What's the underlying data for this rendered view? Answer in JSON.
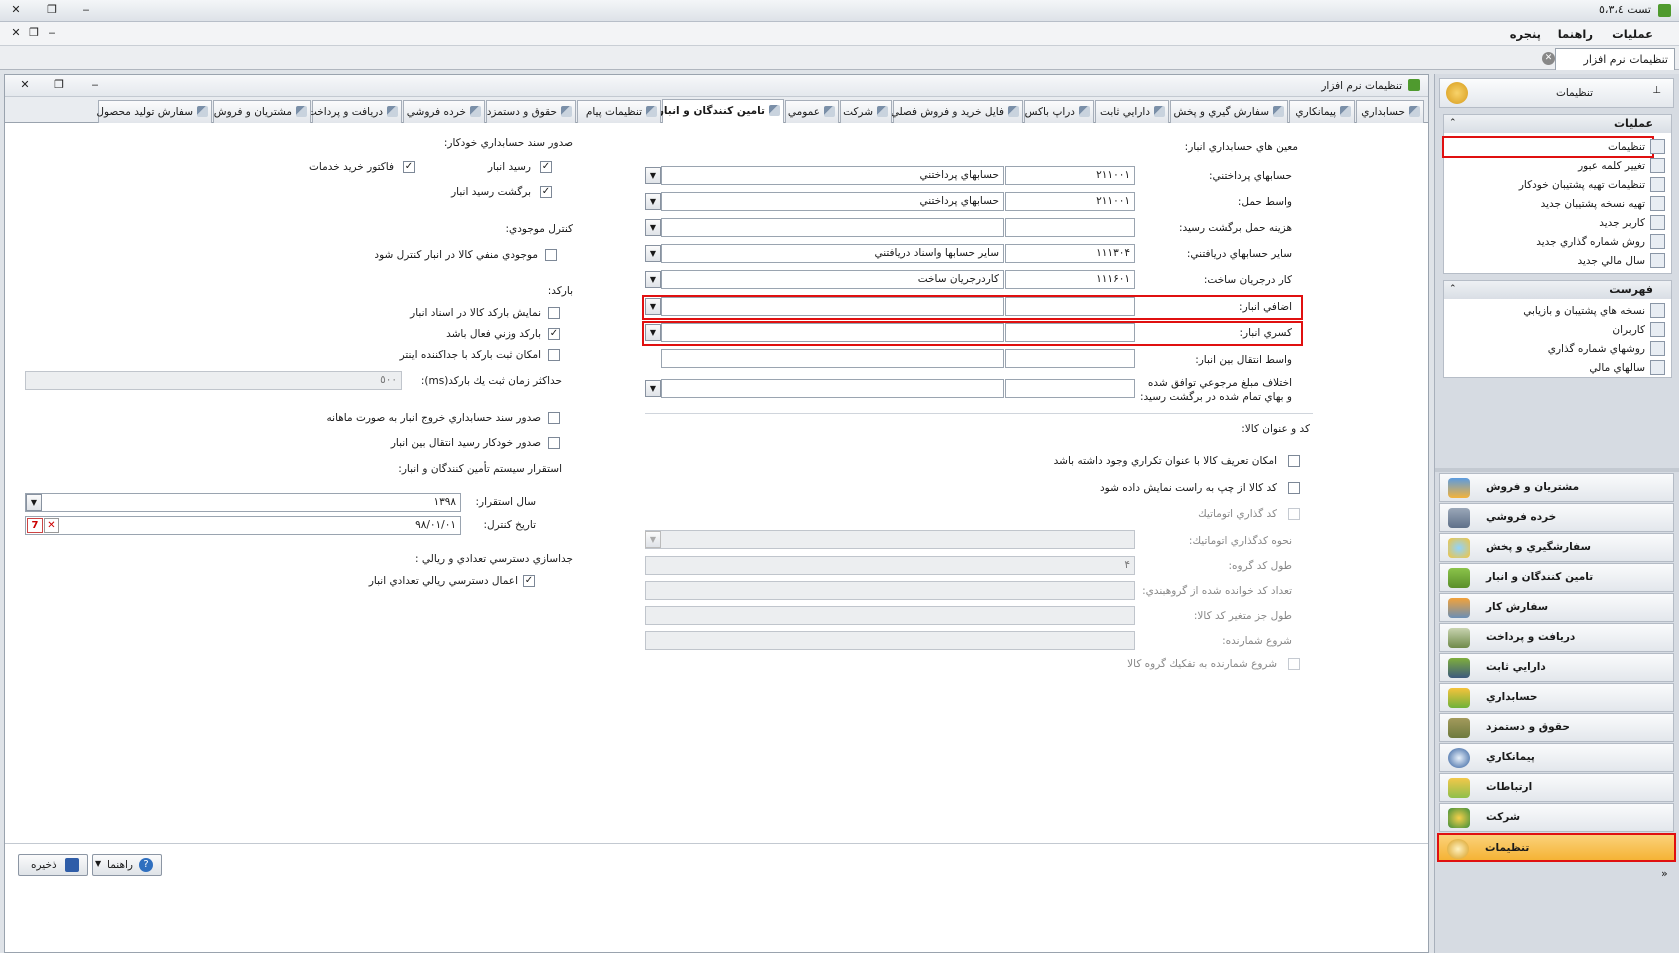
{
  "window": {
    "title": "تست ٥،٣،٤"
  },
  "menu": [
    "عمليات",
    "راهنما",
    "پنجره"
  ],
  "doc_tab": "تنظيمات نرم افزار",
  "form": {
    "title": "تنظيمات نرم افزار",
    "tabs": [
      "حسابداري",
      "پيمانكاري",
      "سفارش گيري و پخش",
      "دارايي ثابت",
      "دراپ باكس",
      "فايل خريد و فروش فصلي",
      "شركت",
      "عمومي",
      "تامين كنندگان و انبار",
      "تنظيمات پيام",
      "حقوق و دستمزد",
      "خرده فروشي",
      "دريافت و پرداخت",
      "مشتريان و فروش",
      "سفارش توليد محصول"
    ],
    "active_tab": "تامين كنندگان و انبار",
    "right": {
      "section_accounts": "معين هاي حسابداري انبار:",
      "rows": [
        {
          "label": "حسابهاي پرداختني:",
          "code": "٢١١٠٠١",
          "name": "حسابهاي پرداختني"
        },
        {
          "label": "واسط حمل:",
          "code": "٢١١٠٠١",
          "name": "حسابهاي پرداختني"
        },
        {
          "label": "هزينه حمل برگشت رسيد:",
          "code": "",
          "name": ""
        },
        {
          "label": "ساير حسابهاي دريافتني:",
          "code": "١١١٣٠۴",
          "name": "ساير حسابها واسناد دريافتني"
        },
        {
          "label": "كار درجريان ساخت:",
          "code": "١١١۶٠١",
          "name": "كاردرجريان ساخت"
        },
        {
          "label": "اضافي انبار:",
          "code": "",
          "name": ""
        },
        {
          "label": "كسري انبار:",
          "code": "",
          "name": ""
        },
        {
          "label": "واسط انتقال بين انبار:",
          "code": "",
          "name": ""
        },
        {
          "label": "اختلاف مبلغ مرجوعي توافق شده",
          "label2": "و بهاي تمام شده در برگشت رسيد:",
          "code": "",
          "name": ""
        }
      ],
      "section_code": "كد و عنوان كالا:",
      "cb_dup": "امكان تعريف كالا با عنوان تكراري وجود داشته باشد",
      "cb_ltr": "كد كالا از چپ به راست نمايش داده شود",
      "cb_auto": "كد گذاري اتوماتيك",
      "auto_method": "نحوه كدگذاري اتوماتيك:",
      "group_len": "طول كد گروه:",
      "group_len_val": "۴",
      "group_count": "تعداد كد خوانده شده از گروهبندي:",
      "var_len": "طول جز متغير كد كالا:",
      "counter_start": "شروع شمارنده:",
      "cb_counter_sep": "شروع شمارنده به تفكيك گروه كالا"
    },
    "left": {
      "section_doc": "صدور سند حسابداري خودكار:",
      "cb_receipt": "رسيد انبار",
      "cb_invoice": "فاكتور خريد خدمات",
      "cb_return": "برگشت رسيد انبار",
      "section_stock": "كنترل موجودي:",
      "cb_negative": "موجودي منفي كالا در انبار كنترل شود",
      "section_barcode": "باركد:",
      "cb_show_barcode": "نمايش باركد كالا در اسناد انبار",
      "cb_weight": "باركد وزني فعال باشد",
      "cb_separator": "امكان ثبت باركد با جداكننده اينتر",
      "max_time": "حداكثر زمان ثبت يك باركد(ms):",
      "max_time_val": "٥٠٠",
      "cb_monthly": "صدور سند حسابداري خروج انبار به صورت ماهانه",
      "cb_transfer": "صدور خودكار رسيد انتقال بين انبار",
      "section_deploy": "استقرار سيستم تأمين كنندگان و انبار:",
      "deploy_year": "سال استقرار:",
      "deploy_year_val": "١٣٩٨",
      "control_date": "تاريخ كنترل:",
      "control_date_val": "٩٨/٠١/٠١",
      "section_access": "جداسازي دسترسي تعدادي و ريالي :",
      "cb_access": "اعمال دسترسي ريالي تعدادي انبار"
    },
    "buttons": {
      "save": "ذخيره",
      "help": "راهنما"
    }
  },
  "sidebar": {
    "header": "تنظيمات",
    "ops_title": "عمليات",
    "ops": [
      "تنظيمات",
      "تغيير كلمه عبور",
      "تنظيمات تهيه پشتيبان خودكار",
      "تهيه نسخه پشتيبان جديد",
      "كاربر جديد",
      "روش شماره گذاري جديد",
      "سال مالي جديد"
    ],
    "list_title": "فهرست",
    "list": [
      "نسخه هاي پشتيبان و بازيابي",
      "كاربران",
      "روشهاي شماره گذاري",
      "سالهاي مالي"
    ],
    "nav": [
      "مشتريان و فروش",
      "خرده فروشي",
      "سفارشگيري و پخش",
      "تامين كنندگان و انبار",
      "سفارش كار",
      "دريافت و پرداخت",
      "دارايي ثابت",
      "حسابداري",
      "حقوق و دستمزد",
      "پيمانكاري",
      "ارتباطات",
      "شركت",
      "تنظيمات"
    ]
  },
  "colors": {
    "highlight": "#e01010",
    "nav_active": "#f5b335"
  }
}
